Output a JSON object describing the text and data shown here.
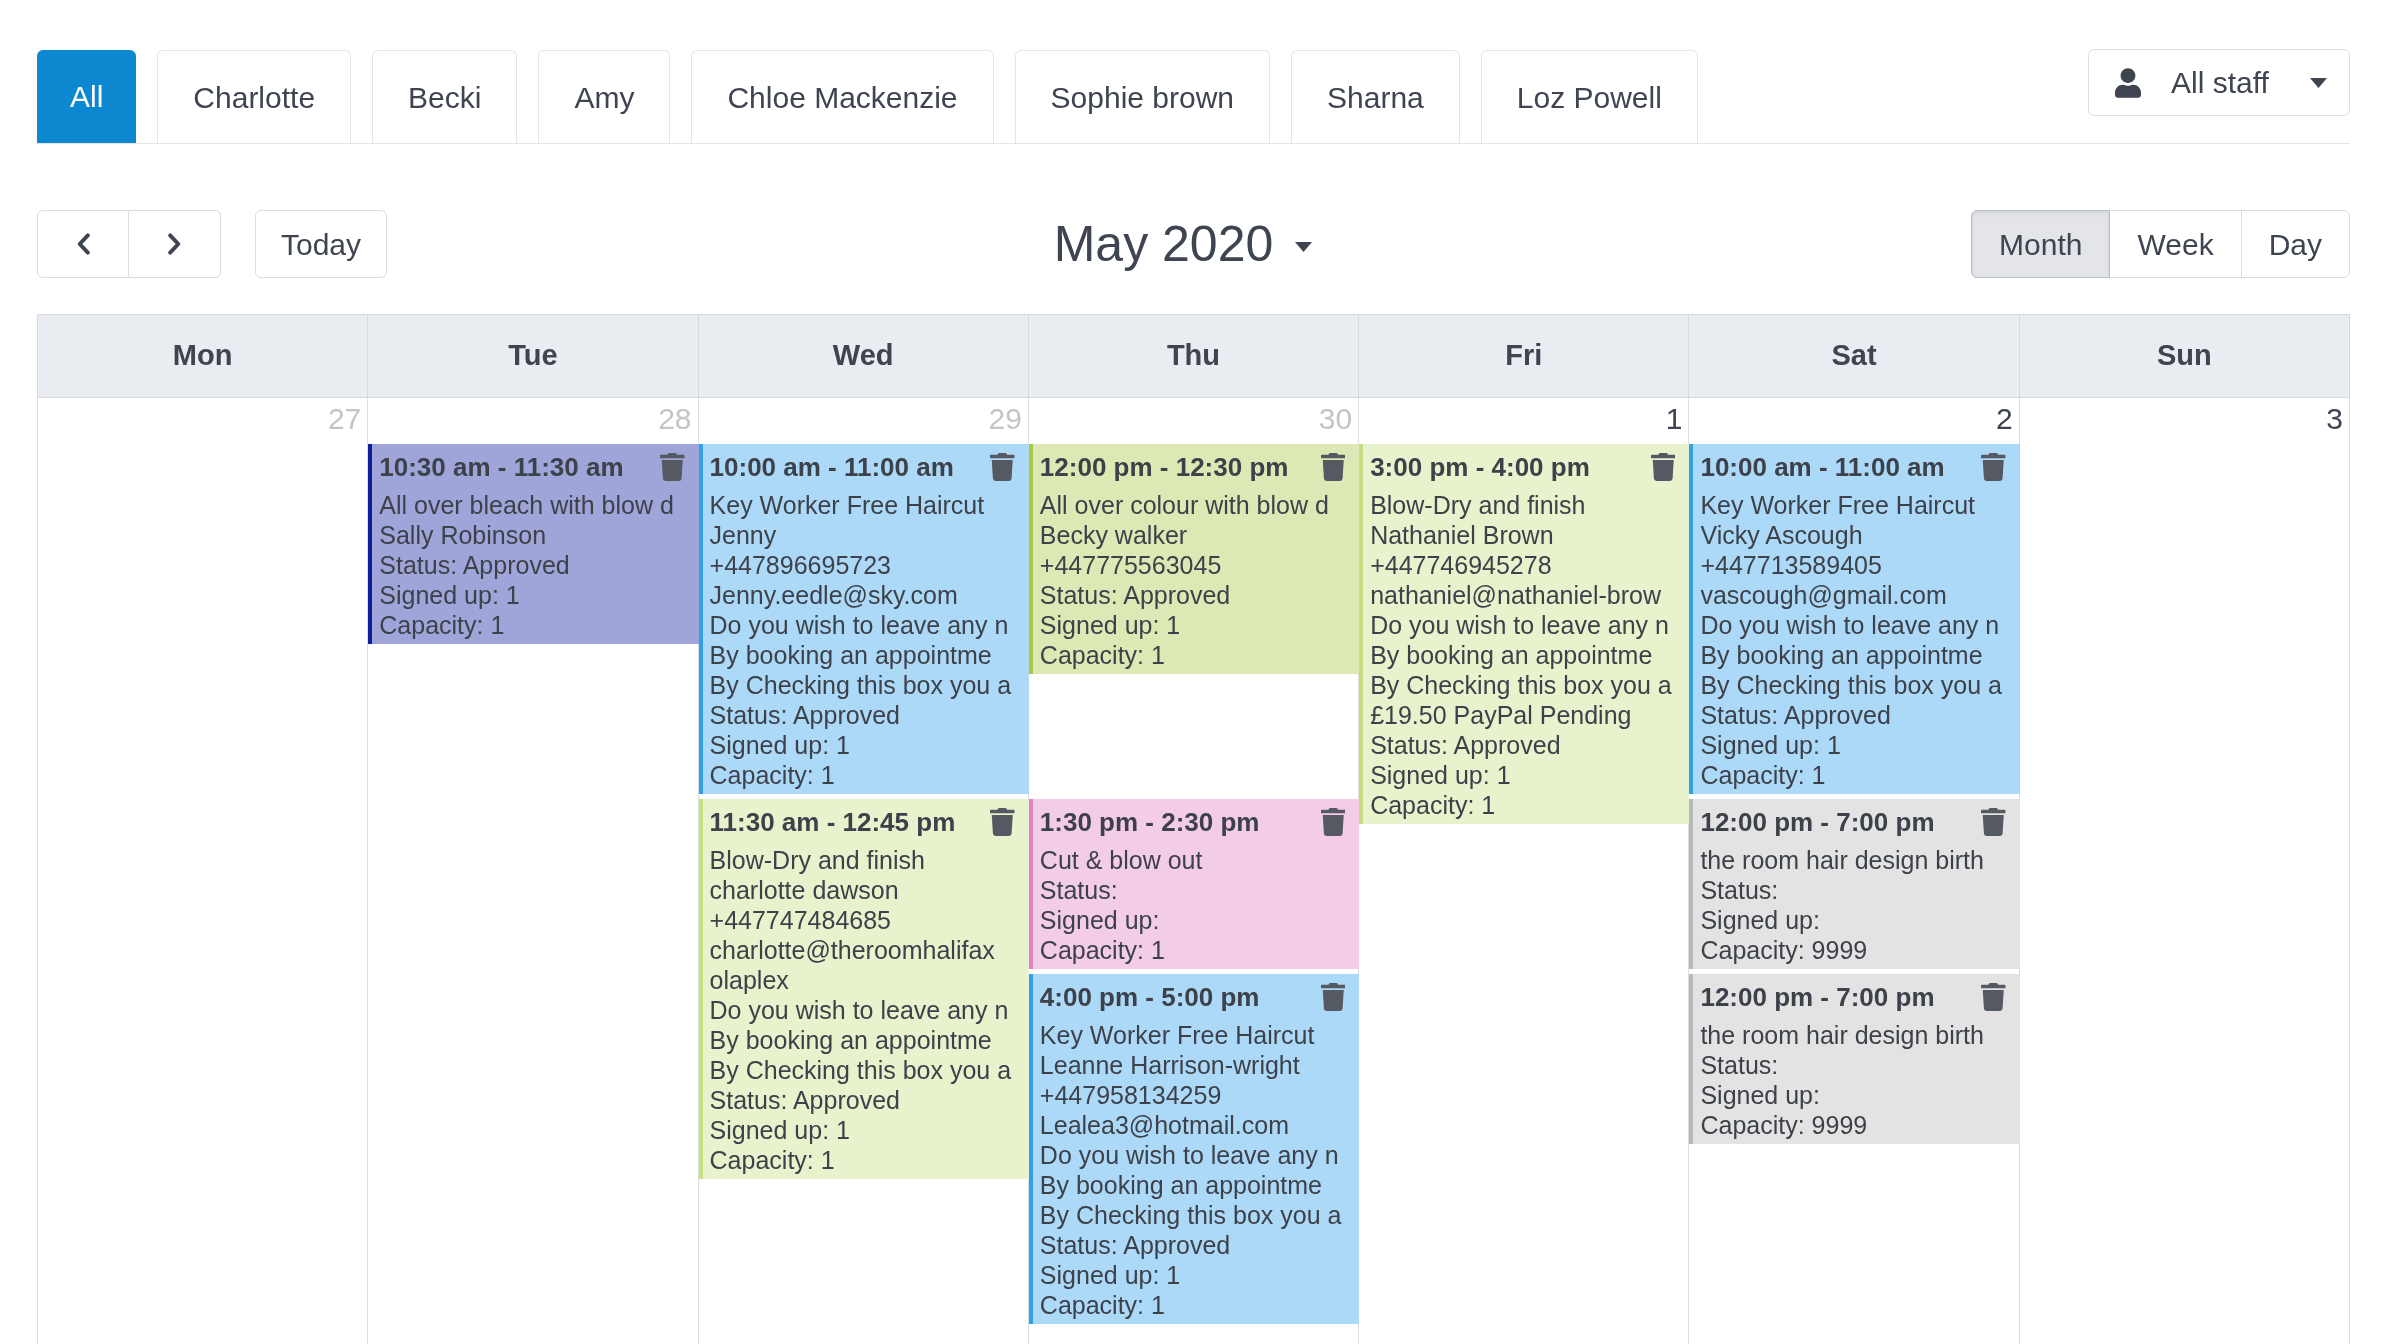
{
  "staff_tabs": [
    {
      "label": "All",
      "selected": true
    },
    {
      "label": "Charlotte",
      "selected": false
    },
    {
      "label": "Becki",
      "selected": false
    },
    {
      "label": "Amy",
      "selected": false
    },
    {
      "label": "Chloe Mackenzie",
      "selected": false
    },
    {
      "label": "Sophie brown",
      "selected": false
    },
    {
      "label": "Sharna",
      "selected": false
    },
    {
      "label": "Loz Powell",
      "selected": false
    }
  ],
  "staff_filter": {
    "label": "All staff"
  },
  "toolbar": {
    "today_button": "Today",
    "title": "May 2020",
    "views": [
      {
        "label": "Month",
        "selected": true
      },
      {
        "label": "Week",
        "selected": false
      },
      {
        "label": "Day",
        "selected": false
      }
    ]
  },
  "calendar": {
    "weekdays": [
      "Mon",
      "Tue",
      "Wed",
      "Thu",
      "Fri",
      "Sat",
      "Sun"
    ],
    "days": [
      {
        "number": "27",
        "other_month": true
      },
      {
        "number": "28",
        "other_month": true,
        "events": [
          {
            "time": "10:30 am - 11:30 am",
            "color": "#0f1e9d",
            "lines": [
              "All over bleach with blow d",
              "Sally Robinson",
              "Status: Approved",
              "Signed up: 1",
              "Capacity: 1"
            ]
          }
        ]
      },
      {
        "number": "29",
        "other_month": true,
        "events": [
          {
            "time": "10:00 am - 11:00 am",
            "color": "#30a0eb",
            "lines": [
              "Key Worker Free Haircut",
              "Jenny",
              "+447896695723",
              "Jenny.eedle@sky.com",
              "Do you wish to leave any n",
              "By booking an appointme",
              "By Checking this box you a",
              "Status: Approved",
              "Signed up: 1",
              "Capacity: 1"
            ]
          },
          {
            "time": "11:30 am - 12:45 pm",
            "color": "#c5de82",
            "lines": [
              "Blow-Dry and finish",
              "charlotte dawson",
              "+447747484685",
              "charlotte@theroomhalifax",
              "olaplex",
              "Do you wish to leave any n",
              "By booking an appointme",
              "By Checking this box you a",
              "Status: Approved",
              "Signed up: 1",
              "Capacity: 1"
            ]
          }
        ]
      },
      {
        "number": "30",
        "other_month": true,
        "events": [
          {
            "time": "12:00 pm - 12:30 pm",
            "color": "#aac846",
            "lines": [
              "All over colour with blow d",
              "Becky walker",
              "+447775563045",
              "Status: Approved",
              "Signed up: 1",
              "Capacity: 1"
            ]
          },
          {
            "time": "1:30 pm - 2:30 pm",
            "color": "#e182c5",
            "lines": [
              "Cut & blow out",
              "Status:",
              "Signed up:",
              "Capacity: 1"
            ]
          },
          {
            "time": "4:00 pm - 5:00 pm",
            "color": "#30a0eb",
            "lines": [
              "Key Worker Free Haircut",
              "Leanne Harrison-wright",
              "+447958134259",
              "Lealea3@hotmail.com",
              "Do you wish to leave any n",
              "By booking an appointme",
              "By Checking this box you a",
              "Status: Approved",
              "Signed up: 1",
              "Capacity: 1"
            ]
          }
        ]
      },
      {
        "number": "1",
        "other_month": false,
        "events": [
          {
            "time": "3:00 pm - 4:00 pm",
            "color": "#c5de82",
            "lines": [
              "Blow-Dry and finish",
              "Nathaniel Brown",
              "+447746945278",
              "nathaniel@nathaniel-brow",
              "Do you wish to leave any n",
              "By booking an appointme",
              "By Checking this box you a",
              "£19.50 PayPal Pending",
              "Status: Approved",
              "Signed up: 1",
              "Capacity: 1"
            ]
          }
        ]
      },
      {
        "number": "2",
        "other_month": false,
        "events": [
          {
            "time": "10:00 am - 11:00 am",
            "color": "#30a0eb",
            "lines": [
              "Key Worker Free Haircut",
              "Vicky Ascough",
              "+447713589405",
              "vascough@gmail.com",
              "Do you wish to leave any n",
              "By booking an appointme",
              "By Checking this box you a",
              "Status: Approved",
              "Signed up: 1",
              "Capacity: 1"
            ]
          },
          {
            "time": "12:00 pm - 7:00 pm",
            "color": "#b9b9b9",
            "lines": [
              "the room hair design birth",
              "Status:",
              "Signed up:",
              "Capacity: 9999"
            ]
          },
          {
            "time": "12:00 pm - 7:00 pm",
            "color": "#b9b9b9",
            "lines": [
              "the room hair design birth",
              "Status:",
              "Signed up:",
              "Capacity: 9999"
            ]
          }
        ]
      },
      {
        "number": "3",
        "other_month": false
      }
    ]
  }
}
